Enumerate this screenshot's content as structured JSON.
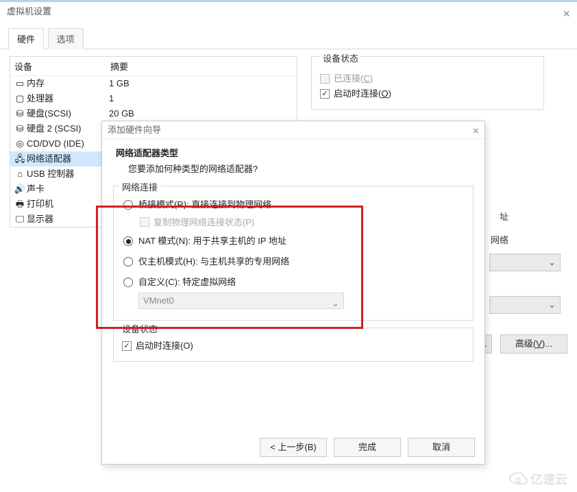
{
  "window": {
    "title": "虚拟机设置"
  },
  "tabs": {
    "hardware": "硬件",
    "options": "选项"
  },
  "hardware_list": {
    "header_device": "设备",
    "header_summary": "摘要",
    "items": [
      {
        "name": "内存",
        "summary": "1 GB",
        "icon": "🗄"
      },
      {
        "name": "处理器",
        "summary": "1",
        "icon": "▭"
      },
      {
        "name": "硬盘(SCSI)",
        "summary": "20 GB",
        "icon": "💽"
      },
      {
        "name": "硬盘 2 (SCSI)",
        "summary": "",
        "icon": "💽"
      },
      {
        "name": "CD/DVD (IDE)",
        "summary": "",
        "icon": "💿"
      },
      {
        "name": "网络适配器",
        "summary": "",
        "icon": "🗗"
      },
      {
        "name": "USB 控制器",
        "summary": "",
        "icon": "🖴"
      },
      {
        "name": "声卡",
        "summary": "",
        "icon": "🔊"
      },
      {
        "name": "打印机",
        "summary": "",
        "icon": "🖨"
      },
      {
        "name": "显示器",
        "summary": "",
        "icon": "🖥"
      }
    ]
  },
  "status_group": {
    "legend": "设备状态",
    "connected": "已连接(C)",
    "connected_letter": "C",
    "connect_at_power_on": "启动时连接(O)",
    "connect_letter": "O"
  },
  "right": {
    "peek1": "址",
    "peek2": "网络",
    "advanced": "高级(V)...",
    "advanced_letter": "V",
    "ellipsis": "..."
  },
  "wizard": {
    "title": "添加硬件向导",
    "heading": "网络适配器类型",
    "subheading": "您要添加何种类型的网络适配器?",
    "group_legend": "网络连接",
    "bridged": "桥接模式(R): 直接连接到物理网络",
    "replicate": "复制物理网络连接状态(P)",
    "nat": "NAT 模式(N): 用于共享主机的 IP 地址",
    "hostonly": "仅主机模式(H): 与主机共享的专用网络",
    "custom": "自定义(C): 特定虚拟网络",
    "vmnet": "VMnet0",
    "status_legend": "设备状态",
    "connect_power_on": "启动时连接(O)",
    "back": "< 上一步(B)",
    "finish": "完成",
    "cancel": "取消"
  },
  "watermark": "亿速云"
}
